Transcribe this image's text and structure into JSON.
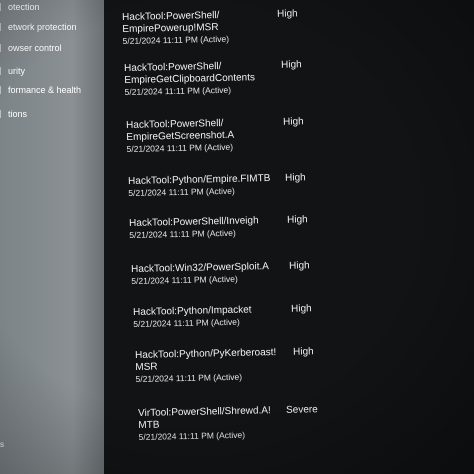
{
  "sidebar": {
    "items": [
      {
        "label": "otection",
        "icon": "virus-protection-icon"
      },
      {
        "label": "etwork protection",
        "icon": "network-icon"
      },
      {
        "label": "owser control",
        "icon": "app-browser-icon"
      },
      {
        "label": "urity",
        "icon": "device-security-icon"
      },
      {
        "label": "formance & health",
        "icon": "health-icon"
      },
      {
        "label": "tions",
        "icon": "family-icon"
      }
    ],
    "bottom_label": "s"
  },
  "threats": [
    {
      "name_line1": "HackTool:PowerShell/",
      "name_line2": "EmpirePowerup!MSR",
      "date": "5/21/2024 11:11 PM (Active)",
      "severity": "High"
    },
    {
      "name_line1": "HackTool:PowerShell/",
      "name_line2": "EmpireGetClipboardContents",
      "date": "5/21/2024 11:11 PM (Active)",
      "severity": "High"
    },
    {
      "name_line1": "HackTool:PowerShell/",
      "name_line2": "EmpireGetScreenshot.A",
      "date": "5/21/2024 11:11 PM (Active)",
      "severity": "High"
    },
    {
      "name_line1": "HackTool:Python/Empire.FIMTB",
      "name_line2": "",
      "date": "5/21/2024 11:11 PM (Active)",
      "severity": "High"
    },
    {
      "name_line1": "HackTool:PowerShell/Inveigh",
      "name_line2": "",
      "date": "5/21/2024 11:11 PM (Active)",
      "severity": "High"
    },
    {
      "name_line1": "HackTool:Win32/PowerSploit.A",
      "name_line2": "",
      "date": "5/21/2024 11:11 PM (Active)",
      "severity": "High"
    },
    {
      "name_line1": "HackTool:Python/Impacket",
      "name_line2": "",
      "date": "5/21/2024 11:11 PM (Active)",
      "severity": "High"
    },
    {
      "name_line1": "HackTool:Python/PyKerberoast!",
      "name_line2": "MSR",
      "date": "5/21/2024 11:11 PM (Active)",
      "severity": "High"
    },
    {
      "name_line1": "VirTool:PowerShell/Shrewd.A!",
      "name_line2": "MTB",
      "date": "5/21/2024 11:11 PM (Active)",
      "severity": "Severe"
    }
  ]
}
